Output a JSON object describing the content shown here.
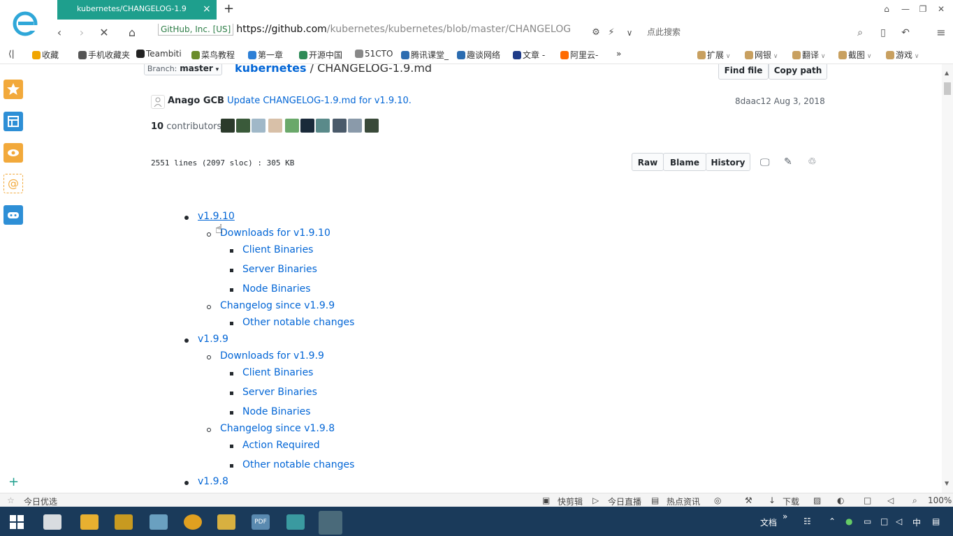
{
  "browser": {
    "tab_title": "kubernetes/CHANGELOG-1.9",
    "tab_close": "×",
    "new_tab": "+",
    "address": {
      "security_label": "GitHub, Inc. [US]",
      "scheme": "https://",
      "domain": "github.com",
      "path": "/kubernetes/kubernetes/blob/master/CHANGELOG"
    },
    "search_hint": "点此搜索",
    "bookmarks": [
      {
        "label": "收藏",
        "icon": "star-icon",
        "color": "#f0a500"
      },
      {
        "label": "手机收藏夹",
        "icon": "phone-icon",
        "color": "#555555"
      },
      {
        "label": "Teambiti",
        "icon": "teambition-icon",
        "color": "#222222"
      },
      {
        "label": "菜鸟教程",
        "icon": "runoob-icon",
        "color": "#6a8c2a"
      },
      {
        "label": "第一章",
        "icon": "doc-icon",
        "color": "#2c7fd6"
      },
      {
        "label": "开源中国",
        "icon": "oschina-icon",
        "color": "#2e8b57"
      },
      {
        "label": "51CTO",
        "icon": "link-icon",
        "color": "#888888"
      },
      {
        "label": "腾讯课堂_",
        "icon": "tencent-icon",
        "color": "#2b6cb0"
      },
      {
        "label": "趣谈网络",
        "icon": "ct-icon",
        "color": "#2b6cb0"
      },
      {
        "label": "文章 -",
        "icon": "blog-icon",
        "color": "#1f3c88"
      },
      {
        "label": "阿里云-",
        "icon": "aliyun-icon",
        "color": "#ff6a00"
      }
    ],
    "bookmarks_more": "»",
    "right_tools": [
      {
        "label": "扩展",
        "icon": "puzzle-icon"
      },
      {
        "label": "网银",
        "icon": "bank-icon"
      },
      {
        "label": "翻译",
        "icon": "translate-icon"
      },
      {
        "label": "截图",
        "icon": "screenshot-icon"
      },
      {
        "label": "游戏",
        "icon": "game-icon"
      }
    ]
  },
  "github": {
    "branch_label": "Branch:",
    "branch": "master",
    "repo": "kubernetes",
    "separator": "/",
    "file": "CHANGELOG-1.9.md",
    "find_file": "Find file",
    "copy_path": "Copy path",
    "commit_author": "Anago GCB",
    "commit_message": "Update CHANGELOG-1.9.md for v1.9.10.",
    "commit_sha": "8daac12",
    "commit_date": "Aug 3, 2018",
    "contributors_count": "10",
    "contributors_label": "contributors",
    "file_stats": "2551 lines (2097 sloc)",
    "file_sep": ":",
    "file_size": "305 KB",
    "raw": "Raw",
    "blame": "Blame",
    "history": "History"
  },
  "toc": [
    {
      "level": 1,
      "text": "v1.9.10"
    },
    {
      "level": 2,
      "text": "Downloads for v1.9.10"
    },
    {
      "level": 3,
      "text": "Client Binaries"
    },
    {
      "level": 3,
      "text": "Server Binaries"
    },
    {
      "level": 3,
      "text": "Node Binaries"
    },
    {
      "level": 2,
      "text": "Changelog since v1.9.9"
    },
    {
      "level": 3,
      "text": "Other notable changes"
    },
    {
      "level": 1,
      "text": "v1.9.9"
    },
    {
      "level": 2,
      "text": "Downloads for v1.9.9"
    },
    {
      "level": 3,
      "text": "Client Binaries"
    },
    {
      "level": 3,
      "text": "Server Binaries"
    },
    {
      "level": 3,
      "text": "Node Binaries"
    },
    {
      "level": 2,
      "text": "Changelog since v1.9.8"
    },
    {
      "level": 3,
      "text": "Action Required"
    },
    {
      "level": 3,
      "text": "Other notable changes"
    },
    {
      "level": 1,
      "text": "v1.9.8"
    }
  ],
  "statusbar": {
    "left": "今日优选",
    "quick_cut": "快剪辑",
    "live": "今日直播",
    "news": "热点资讯",
    "download": "下载",
    "zoom": "100%"
  },
  "taskbar": {
    "docs": "文档",
    "more": "»",
    "ime": "中"
  },
  "colors": {
    "tab_active": "#1e9f8d",
    "link": "#0366d6",
    "taskbar": "#1a3a5a"
  }
}
